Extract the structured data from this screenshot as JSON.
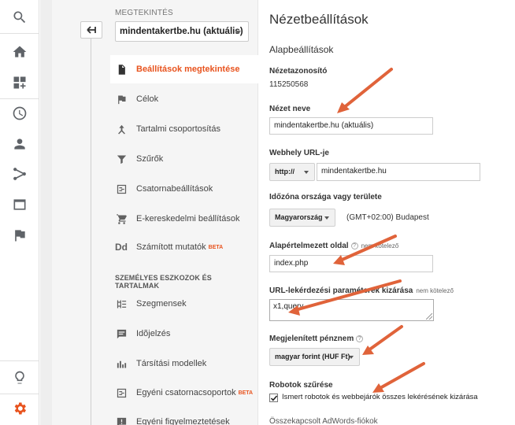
{
  "view_panel": {
    "label": "MEGTEKINTÉS",
    "selected_view": "mindentakertbe.hu (aktuális)",
    "menu": [
      {
        "label": "Beállítások megtekintése",
        "icon": "document-icon",
        "active": true
      },
      {
        "label": "Célok",
        "icon": "flag-icon"
      },
      {
        "label": "Tartalmi csoportosítás",
        "icon": "grouping-icon"
      },
      {
        "label": "Szűrők",
        "icon": "filter-icon"
      },
      {
        "label": "Csatornabeállítások",
        "icon": "channel-settings-icon"
      },
      {
        "label": "E-kereskedelmi beállítások",
        "icon": "cart-icon"
      },
      {
        "label": "Számított mutatók",
        "icon": "dd-icon",
        "badge": "BETA"
      }
    ],
    "section_title": "SZEMÉLYES ESZKOZOK ÉS TARTALMAK",
    "personal": [
      {
        "label": "Szegmensek",
        "icon": "segments-icon"
      },
      {
        "label": "Idõjelzés",
        "icon": "annotation-icon"
      },
      {
        "label": "Társítási modellek",
        "icon": "bar-chart-icon"
      },
      {
        "label": "Egyéni csatornacsoportok",
        "icon": "channel-groups-icon",
        "badge": "BETA"
      },
      {
        "label": "Egyéni figyelmeztetések",
        "icon": "alert-icon"
      }
    ]
  },
  "main": {
    "title": "Nézetbeállítások",
    "subtitle": "Alapbeállítások",
    "view_id_label": "Nézetazonosító",
    "view_id": "115250568",
    "view_name_label": "Nézet neve",
    "view_name": "mindentakertbe.hu (aktuális)",
    "website_url_label": "Webhely URL-je",
    "protocol": "http://",
    "website_url": "mindentakertbe.hu",
    "timezone_label": "Időzóna országa vagy területe",
    "timezone_country": "Magyarország",
    "timezone_value": "(GMT+02:00) Budapest",
    "default_page_label": "Alapértelmezett oldal",
    "optional": "nem kötelező",
    "default_page": "index.php",
    "exclude_params_label": "URL-lekérdezési paraméterek kizárása",
    "exclude_params": "x1,query.",
    "currency_label": "Megjelenített pénznem",
    "currency": "magyar forint (HUF Ft)",
    "bot_filter_label": "Robotok szűrése",
    "bot_filter_text": "Ismert robotok és webbejárók összes lekérésének kizárása",
    "bot_filter_checked": true,
    "cutoff_text": "Összekapcsolt AdWords-fiókok"
  },
  "colors": {
    "accent": "#e8531e",
    "arrow": "#e0633a"
  }
}
